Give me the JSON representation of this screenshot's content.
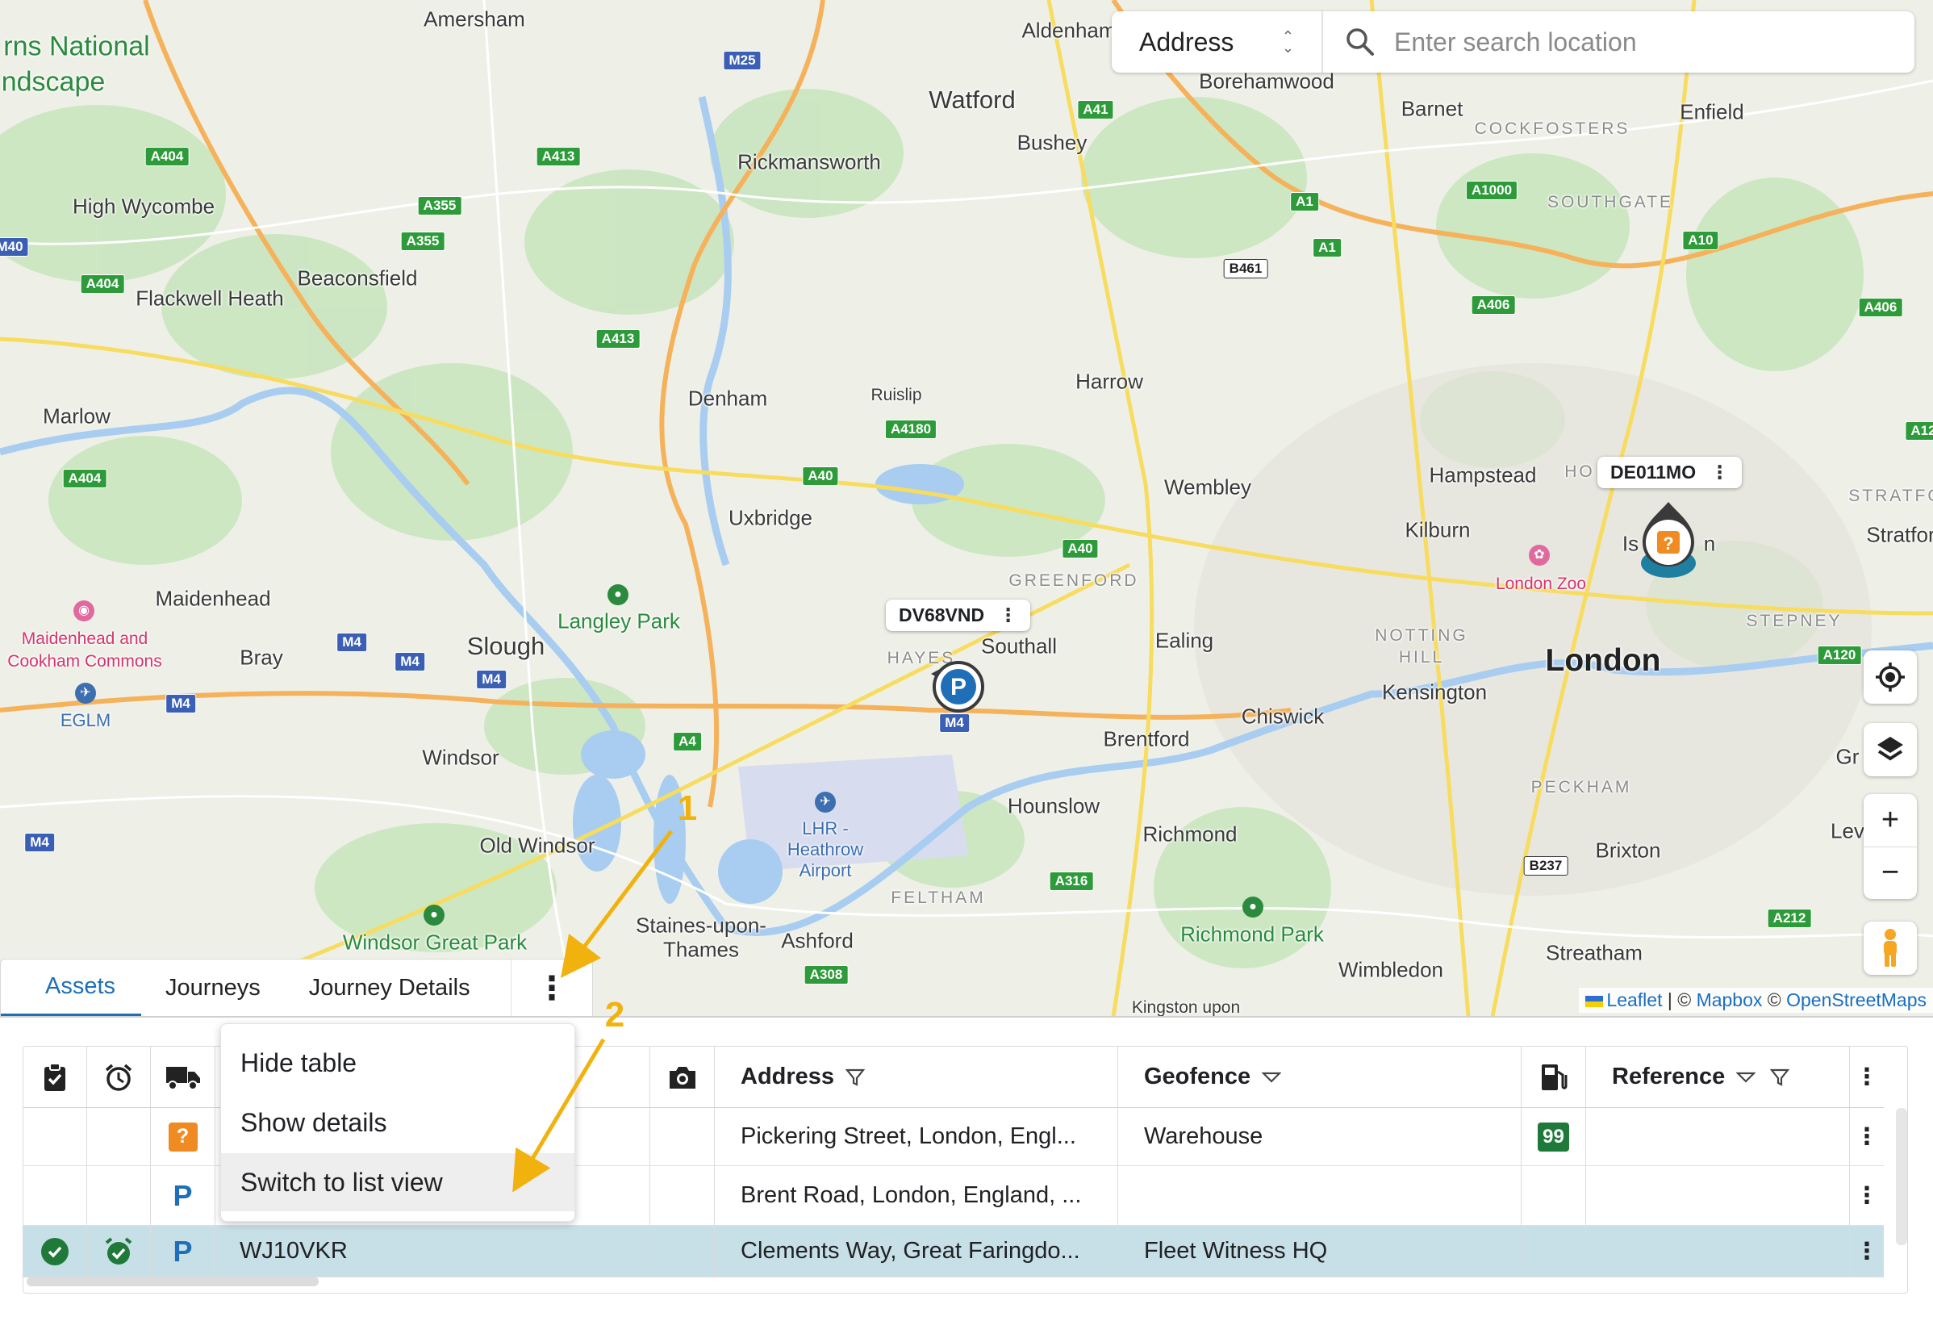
{
  "map": {
    "places": [
      {
        "name": "Amersham",
        "cls": ""
      },
      {
        "name": "Aldenham",
        "cls": ""
      },
      {
        "name": "Watford",
        "cls": "lg"
      },
      {
        "name": "Borehamwood",
        "cls": ""
      },
      {
        "name": "Barnet",
        "cls": ""
      },
      {
        "name": "Enfield",
        "cls": ""
      },
      {
        "name": "COCKFOSTERS",
        "cls": "area"
      },
      {
        "name": "SOUTHGATE",
        "cls": "area"
      },
      {
        "name": "Bushey",
        "cls": ""
      },
      {
        "name": "Rickmansworth",
        "cls": ""
      },
      {
        "name": "High Wycombe",
        "cls": ""
      },
      {
        "name": "Beaconsfield",
        "cls": ""
      },
      {
        "name": "Flackwell Heath",
        "cls": ""
      },
      {
        "name": "Harrow",
        "cls": ""
      },
      {
        "name": "Ruislip",
        "cls": "sm"
      },
      {
        "name": "Denham",
        "cls": ""
      },
      {
        "name": "Marlow",
        "cls": ""
      },
      {
        "name": "Hampstead",
        "cls": ""
      },
      {
        "name": "Wembley",
        "cls": ""
      },
      {
        "name": "Kilburn",
        "cls": ""
      },
      {
        "name": "Uxbridge",
        "cls": ""
      },
      {
        "name": "GREENFORD",
        "cls": "area"
      },
      {
        "name": "Maidenhead",
        "cls": ""
      },
      {
        "name": "Langley Park",
        "cls": "green"
      },
      {
        "name": "Slough",
        "cls": "lg"
      },
      {
        "name": "Bray",
        "cls": ""
      },
      {
        "name": "Southall",
        "cls": ""
      },
      {
        "name": "HAYES",
        "cls": "area"
      },
      {
        "name": "Ealing",
        "cls": ""
      },
      {
        "name": "NOTTING",
        "cls": "area"
      },
      {
        "name": "HILL",
        "cls": "area"
      },
      {
        "name": "London",
        "cls": "big"
      },
      {
        "name": "STEPNEY",
        "cls": "area"
      },
      {
        "name": "Kensington",
        "cls": ""
      },
      {
        "name": "Chiswick",
        "cls": ""
      },
      {
        "name": "Brentford",
        "cls": ""
      },
      {
        "name": "Windsor",
        "cls": ""
      },
      {
        "name": "Hounslow",
        "cls": ""
      },
      {
        "name": "Richmond",
        "cls": ""
      },
      {
        "name": "PECKHAM",
        "cls": "area"
      },
      {
        "name": "Brixton",
        "cls": ""
      },
      {
        "name": "Old Windsor",
        "cls": ""
      },
      {
        "name": "FELTHAM",
        "cls": "area"
      },
      {
        "name": "Staines-upon-",
        "cls": ""
      },
      {
        "name": "Thames",
        "cls": ""
      },
      {
        "name": "Ashford",
        "cls": ""
      },
      {
        "name": "Windsor Great Park",
        "cls": "green"
      },
      {
        "name": "Richmond Park",
        "cls": "green"
      },
      {
        "name": "Wimbledon",
        "cls": ""
      },
      {
        "name": "Streatham",
        "cls": ""
      },
      {
        "name": "Stratfor",
        "cls": ""
      },
      {
        "name": "STRATFO",
        "cls": "area"
      },
      {
        "name": "Gr",
        "cls": ""
      },
      {
        "name": "Lev",
        "cls": ""
      },
      {
        "name": "Is",
        "cls": ""
      },
      {
        "name": "n",
        "cls": ""
      },
      {
        "name": "HO",
        "cls": "area"
      },
      {
        "name": "London Zoo",
        "cls": "pink"
      },
      {
        "name": "Maidenhead and",
        "cls": "pink"
      },
      {
        "name": "Cookham Commons",
        "cls": "pink"
      },
      {
        "name": "EGLM",
        "cls": "blue"
      },
      {
        "name": "LHR -",
        "cls": "blue"
      },
      {
        "name": "Heathrow",
        "cls": "blue"
      },
      {
        "name": "Airport",
        "cls": "blue"
      },
      {
        "name": "rns National",
        "cls": "park"
      },
      {
        "name": "ndscape",
        "cls": "park"
      },
      {
        "name": "Kingston upon",
        "cls": "sm"
      }
    ],
    "shields": [
      {
        "t": "A404",
        "k": "a"
      },
      {
        "t": "A413",
        "k": "a"
      },
      {
        "t": "A355",
        "k": "a"
      },
      {
        "t": "A355",
        "k": "a"
      },
      {
        "t": "A404",
        "k": "a"
      },
      {
        "t": "A413",
        "k": "a"
      },
      {
        "t": "A404",
        "k": "a"
      },
      {
        "t": "M25",
        "k": "m"
      },
      {
        "t": "A41",
        "k": "a"
      },
      {
        "t": "A1",
        "k": "a"
      },
      {
        "t": "A1",
        "k": "a"
      },
      {
        "t": "A1000",
        "k": "a"
      },
      {
        "t": "A10",
        "k": "a"
      },
      {
        "t": "B461",
        "k": "b"
      },
      {
        "t": "A406",
        "k": "a"
      },
      {
        "t": "A406",
        "k": "a"
      },
      {
        "t": "A4180",
        "k": "a"
      },
      {
        "t": "A40",
        "k": "a"
      },
      {
        "t": "A40",
        "k": "a"
      },
      {
        "t": "M4",
        "k": "m"
      },
      {
        "t": "M4",
        "k": "m"
      },
      {
        "t": "M4",
        "k": "m"
      },
      {
        "t": "M4",
        "k": "m"
      },
      {
        "t": "M4",
        "k": "m"
      },
      {
        "t": "M4",
        "k": "m"
      },
      {
        "t": "A4",
        "k": "a"
      },
      {
        "t": "A316",
        "k": "a"
      },
      {
        "t": "A308",
        "k": "a"
      },
      {
        "t": "B237",
        "k": "b"
      },
      {
        "t": "A212",
        "k": "a"
      },
      {
        "t": "A120",
        "k": "a"
      },
      {
        "t": "A12",
        "k": "a"
      },
      {
        "t": "M40",
        "k": "m"
      }
    ],
    "markers": [
      {
        "plate": "DV68VND",
        "menu": "⋮",
        "icon": "P"
      },
      {
        "plate": "DE011MO",
        "menu": "⋮",
        "icon": "?"
      }
    ],
    "attribution": {
      "leaflet": "Leaflet",
      "sep1": " | © ",
      "mapbox": "Mapbox",
      "sep2": " © ",
      "osm": "OpenStreetMaps"
    }
  },
  "search": {
    "mode": "Address",
    "placeholder": "Enter search location"
  },
  "controls": {
    "locate": "locate-icon",
    "layers": "layers-icon",
    "zoom_in": "+",
    "zoom_out": "−",
    "pegman": "pegman-icon"
  },
  "tabs": [
    {
      "label": "Assets",
      "active": true
    },
    {
      "label": "Journeys",
      "active": false
    },
    {
      "label": "Journey Details",
      "active": false
    }
  ],
  "tabs_menu": "⋮",
  "dropdown": {
    "items": [
      {
        "label": "Hide table"
      },
      {
        "label": "Show details"
      },
      {
        "label": "Switch to list view"
      }
    ]
  },
  "table": {
    "headers": {
      "address": "Address",
      "geofence": "Geofence",
      "reference": "Reference",
      "actions": "⋮"
    },
    "rows": [
      {
        "status_icon": "question",
        "plate": "",
        "address": "Pickering Street, London, Engl...",
        "geofence": "Warehouse",
        "fuel": "99",
        "reference": "",
        "selected": false,
        "actions": "⋮"
      },
      {
        "status_icon": "parking",
        "plate": "",
        "address": "Brent Road, London, England, ...",
        "geofence": "",
        "fuel": "",
        "reference": "",
        "selected": false,
        "actions": "⋮"
      },
      {
        "status_icon": "parking",
        "plate": "WJ10VKR",
        "address": "Clements Way, Great Faringdo...",
        "geofence": "Fleet Witness HQ",
        "fuel": "",
        "reference": "",
        "selected": true,
        "actions": "⋮"
      }
    ]
  },
  "annotations": [
    {
      "n": "1"
    },
    {
      "n": "2"
    }
  ],
  "colors": {
    "accent": "#1f6fb8",
    "annotation": "#f2b20e",
    "status_green": "#1f7a3a",
    "status_orange": "#ef8b22",
    "selected_row": "#c7dfe6"
  }
}
